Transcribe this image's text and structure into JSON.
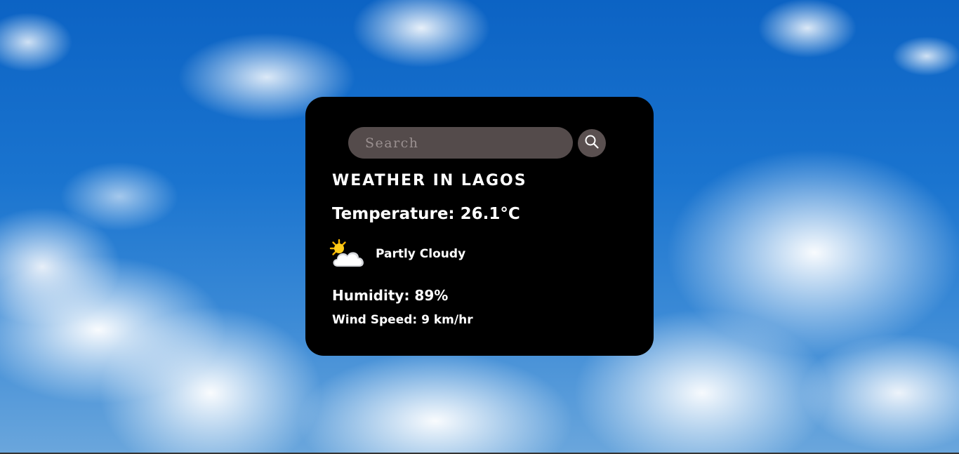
{
  "search": {
    "placeholder": "Search",
    "value": "",
    "button_icon": "search-icon"
  },
  "weather": {
    "city_title": "WEATHER IN LAGOS",
    "temperature": "Temperature: 26.1°C",
    "condition_icon": "partly-cloudy-icon",
    "condition": "Partly Cloudy",
    "humidity": "Humidity: 89%",
    "wind_speed": "Wind Speed: 9 km/hr"
  },
  "colors": {
    "card_background": "#000000",
    "search_background": "#544b4b",
    "text": "#ffffff"
  }
}
